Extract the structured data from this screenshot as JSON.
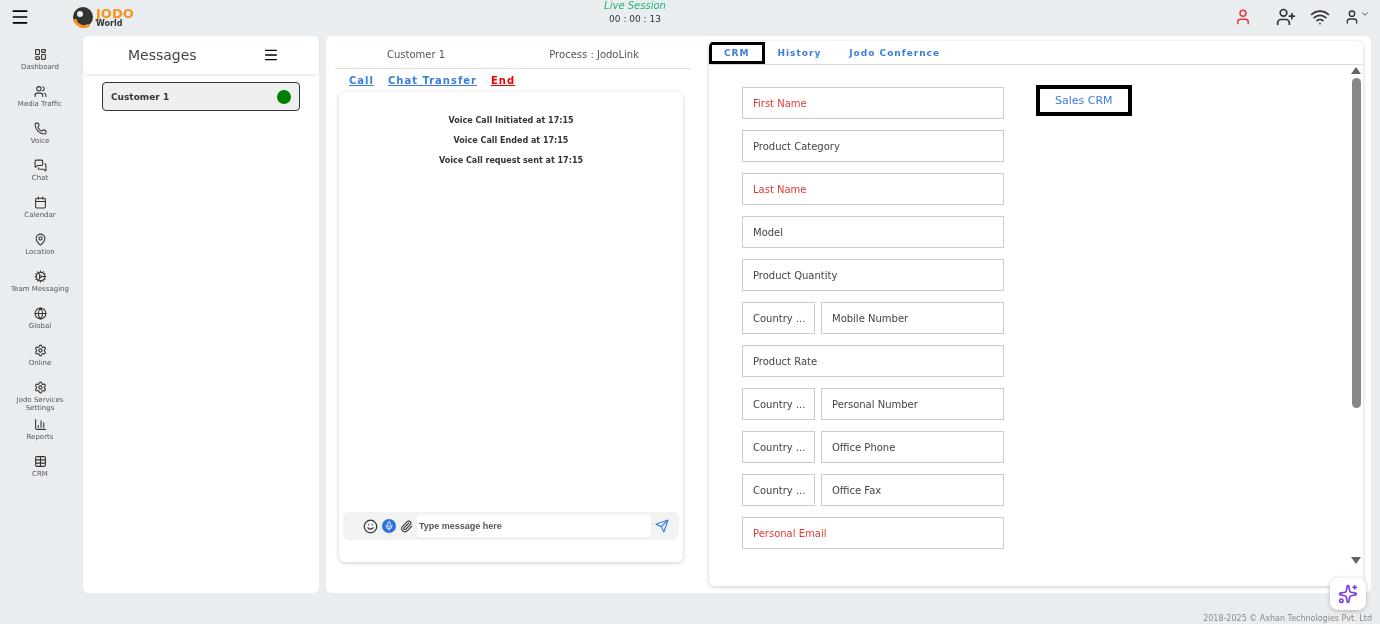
{
  "header": {
    "logo_title": "JODO",
    "logo_subtitle": "World",
    "session_label": "Live Session",
    "session_timer": "00 : 00 : 13"
  },
  "sidebar": {
    "items": [
      {
        "label": "Dashboard"
      },
      {
        "label": "Media Traffic"
      },
      {
        "label": "Voice"
      },
      {
        "label": "Chat"
      },
      {
        "label": "Calendar"
      },
      {
        "label": "Location"
      },
      {
        "label": "Team Messaging"
      },
      {
        "label": "Global"
      },
      {
        "label": "Online"
      },
      {
        "label": "Jodo Services Settings"
      },
      {
        "label": "Reports"
      },
      {
        "label": "CRM"
      }
    ]
  },
  "messages": {
    "title": "Messages",
    "contacts": [
      {
        "name": "Customer 1",
        "selected": true,
        "color": "#008000"
      }
    ]
  },
  "chat": {
    "customer": "Customer 1",
    "process": "Process : JodoLink",
    "actions": [
      {
        "label": "Call",
        "kind": "normal"
      },
      {
        "label": "Chat Transfer",
        "kind": "normal"
      },
      {
        "label": "End",
        "kind": "danger"
      }
    ],
    "events": [
      "Voice Call Initiated at 17:15",
      "Voice Call Ended at 17:15",
      "Voice Call request sent at 17:15"
    ],
    "input": {
      "placeholder": "Type message here"
    }
  },
  "crm": {
    "tabs": [
      {
        "label": "CRM",
        "selected": true
      },
      {
        "label": "History",
        "selected": false
      },
      {
        "label": "Jodo Confernce",
        "selected": false
      }
    ],
    "form_tab": {
      "label": "Sales CRM",
      "selected": true
    },
    "fields": [
      {
        "kind": "text",
        "placeholder": "First Name",
        "required": true
      },
      {
        "kind": "text",
        "placeholder": "Product Category",
        "required": false
      },
      {
        "kind": "text",
        "placeholder": "Last Name",
        "required": true
      },
      {
        "kind": "text",
        "placeholder": "Model",
        "required": false
      },
      {
        "kind": "text",
        "placeholder": "Product Quantity",
        "required": false
      },
      {
        "kind": "phone",
        "country": "Country ...",
        "placeholder": "Mobile Number",
        "required": false
      },
      {
        "kind": "text",
        "placeholder": "Product Rate",
        "required": false
      },
      {
        "kind": "phone",
        "country": "Country ...",
        "placeholder": "Personal Number",
        "required": false
      },
      {
        "kind": "phone",
        "country": "Country ...",
        "placeholder": "Office Phone",
        "required": false
      },
      {
        "kind": "phone",
        "country": "Country ...",
        "placeholder": "Office Fax",
        "required": false
      },
      {
        "kind": "text",
        "placeholder": "Personal Email",
        "required": true
      }
    ]
  },
  "footer": {
    "copyright": "2018-2025 © Axhan Technologies Pvt. Ltd"
  }
}
